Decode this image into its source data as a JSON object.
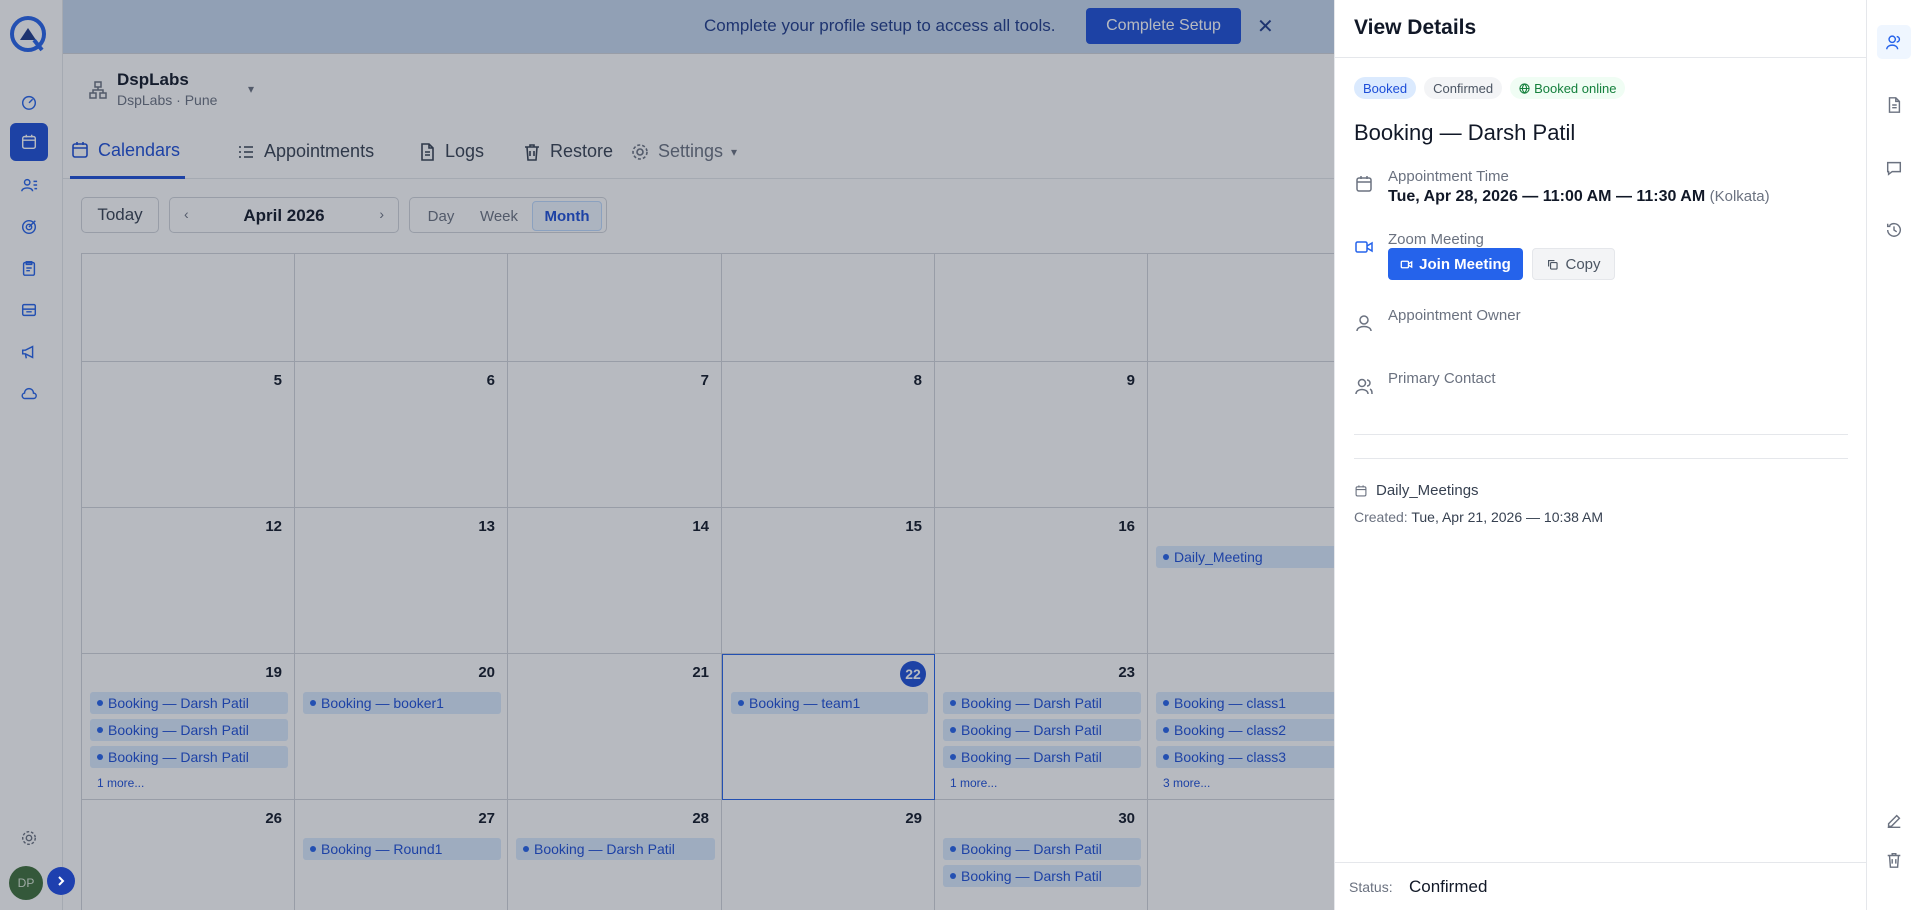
{
  "banner": {
    "message": "Complete your profile setup to access all tools.",
    "button": "Complete Setup",
    "close": "✕"
  },
  "org": {
    "name": "DspLabs",
    "sub": "DspLabs · Pune"
  },
  "nav": {
    "tabs": [
      {
        "label": "Calendars",
        "icon": "calendar-icon",
        "active": true
      },
      {
        "label": "Appointments",
        "icon": "list-icon"
      },
      {
        "label": "Logs",
        "icon": "document-icon"
      },
      {
        "label": "Restore",
        "icon": "trash-icon"
      },
      {
        "label": "Settings",
        "icon": "gear-icon"
      }
    ]
  },
  "toolbar": {
    "today": "Today",
    "month": "April 2026",
    "views": [
      "Day",
      "Week",
      "Month"
    ],
    "active_view": "Month"
  },
  "calendar": {
    "days": {
      "d5": "5",
      "d6": "6",
      "d7": "7",
      "d8": "8",
      "d9": "9",
      "d12": "12",
      "d13": "13",
      "d14": "14",
      "d15": "15",
      "d16": "16",
      "d19": "19",
      "d20": "20",
      "d21": "21",
      "d22": "22",
      "d23": "23",
      "d26": "26",
      "d27": "27",
      "d28": "28",
      "d29": "29",
      "d30": "30"
    },
    "events": {
      "e17": "Daily_Meeting",
      "e19a": "Booking — Darsh Patil",
      "e19b": "Booking — Darsh Patil",
      "e19c": "Booking — Darsh Patil",
      "e19more": "1 more...",
      "e20": "Booking — booker1",
      "e22": "Booking — team1",
      "e23a": "Booking — Darsh Patil",
      "e23b": "Booking — Darsh Patil",
      "e23c": "Booking — Darsh Patil",
      "e23more": "1 more...",
      "e24a": "Booking — class1",
      "e24b": "Booking — class2",
      "e24c": "Booking — class3",
      "e24more": "3 more...",
      "e27": "Booking — Round1",
      "e28": "Booking — Darsh Patil",
      "e30a": "Booking — Darsh Patil",
      "e30b": "Booking — Darsh Patil"
    }
  },
  "rail": {
    "avatar_initials": "DP"
  },
  "drawer": {
    "title": "View Details",
    "tags": {
      "booked": "Booked",
      "confirmed": "Confirmed",
      "online": "Booked online"
    },
    "booking_title": "Booking — Darsh Patil",
    "time_label": "Appointment Time",
    "time_value": "Tue, Apr 28, 2026 — 11:00 AM — 11:30 AM",
    "timezone": "(Kolkata)",
    "meeting_label": "Zoom Meeting",
    "join_button": "Join Meeting",
    "copy_button": "Copy",
    "owner_label": "Appointment Owner",
    "contact_label": "Primary Contact",
    "calendar_name": "Daily_Meetings",
    "created_label": "Created:",
    "created_value": "Tue, Apr 21, 2026 — 10:38 AM",
    "status_label": "Status:",
    "status_value": "Confirmed"
  },
  "colors": {
    "primary": "#1d4ed8",
    "banner_bg": "#c7d9ef",
    "event_bg": "#dbeafe",
    "online_green": "#15803d"
  }
}
